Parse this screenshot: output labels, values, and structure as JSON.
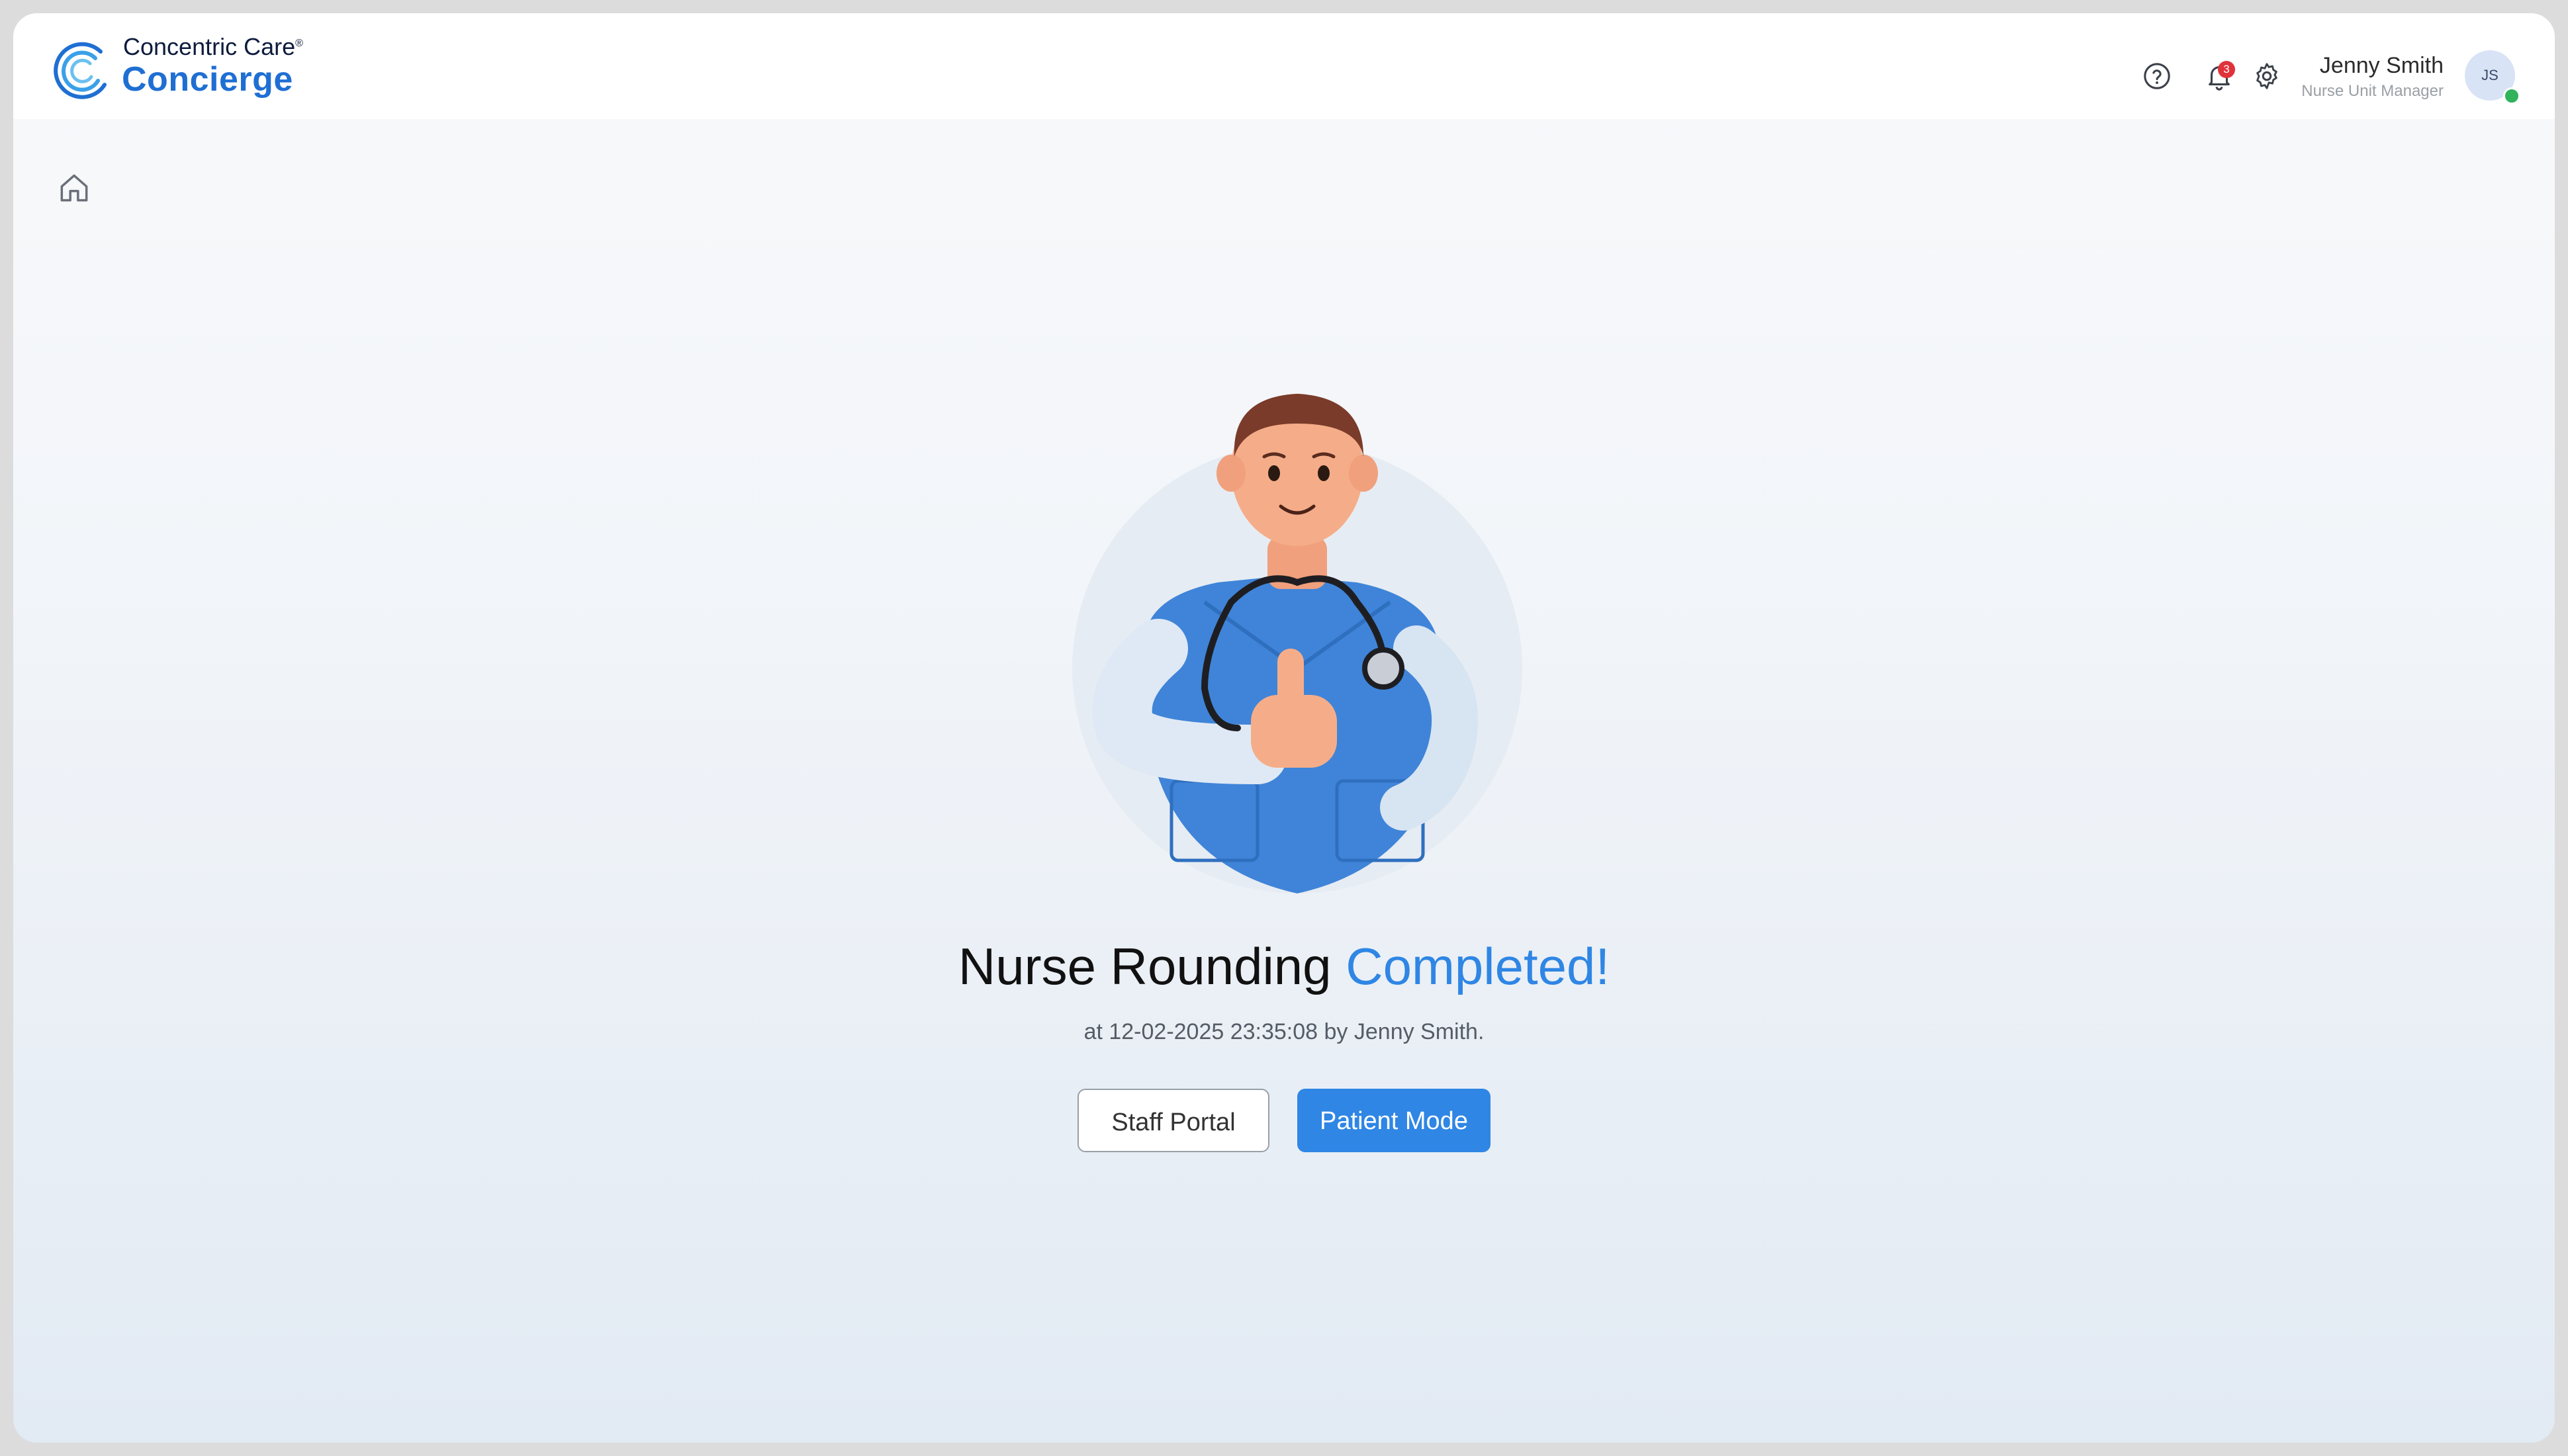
{
  "app": {
    "brand_top": "Concentric Care",
    "brand_reg": "®",
    "brand_name": "Concierge"
  },
  "header": {
    "icons": [
      "help-circle-icon",
      "bell-icon",
      "gear-icon"
    ],
    "notification_count": "3",
    "user": {
      "name": "Jenny Smith",
      "role": "Nurse Unit Manager",
      "initials": "JS",
      "status": "online"
    }
  },
  "nav": {
    "home_icon": "home-icon"
  },
  "main": {
    "headline_prefix": "Nurse Rounding",
    "headline_accent": "Completed!",
    "subline": "at 12-02-2025 23:35:08 by Jenny Smith.",
    "buttons": {
      "staff_portal": "Staff Portal",
      "patient_mode": "Patient Mode"
    }
  },
  "colors": {
    "accent": "#2f86e4",
    "brand": "#1f6fd3",
    "badge": "#e0323a",
    "online": "#2fb35b"
  }
}
